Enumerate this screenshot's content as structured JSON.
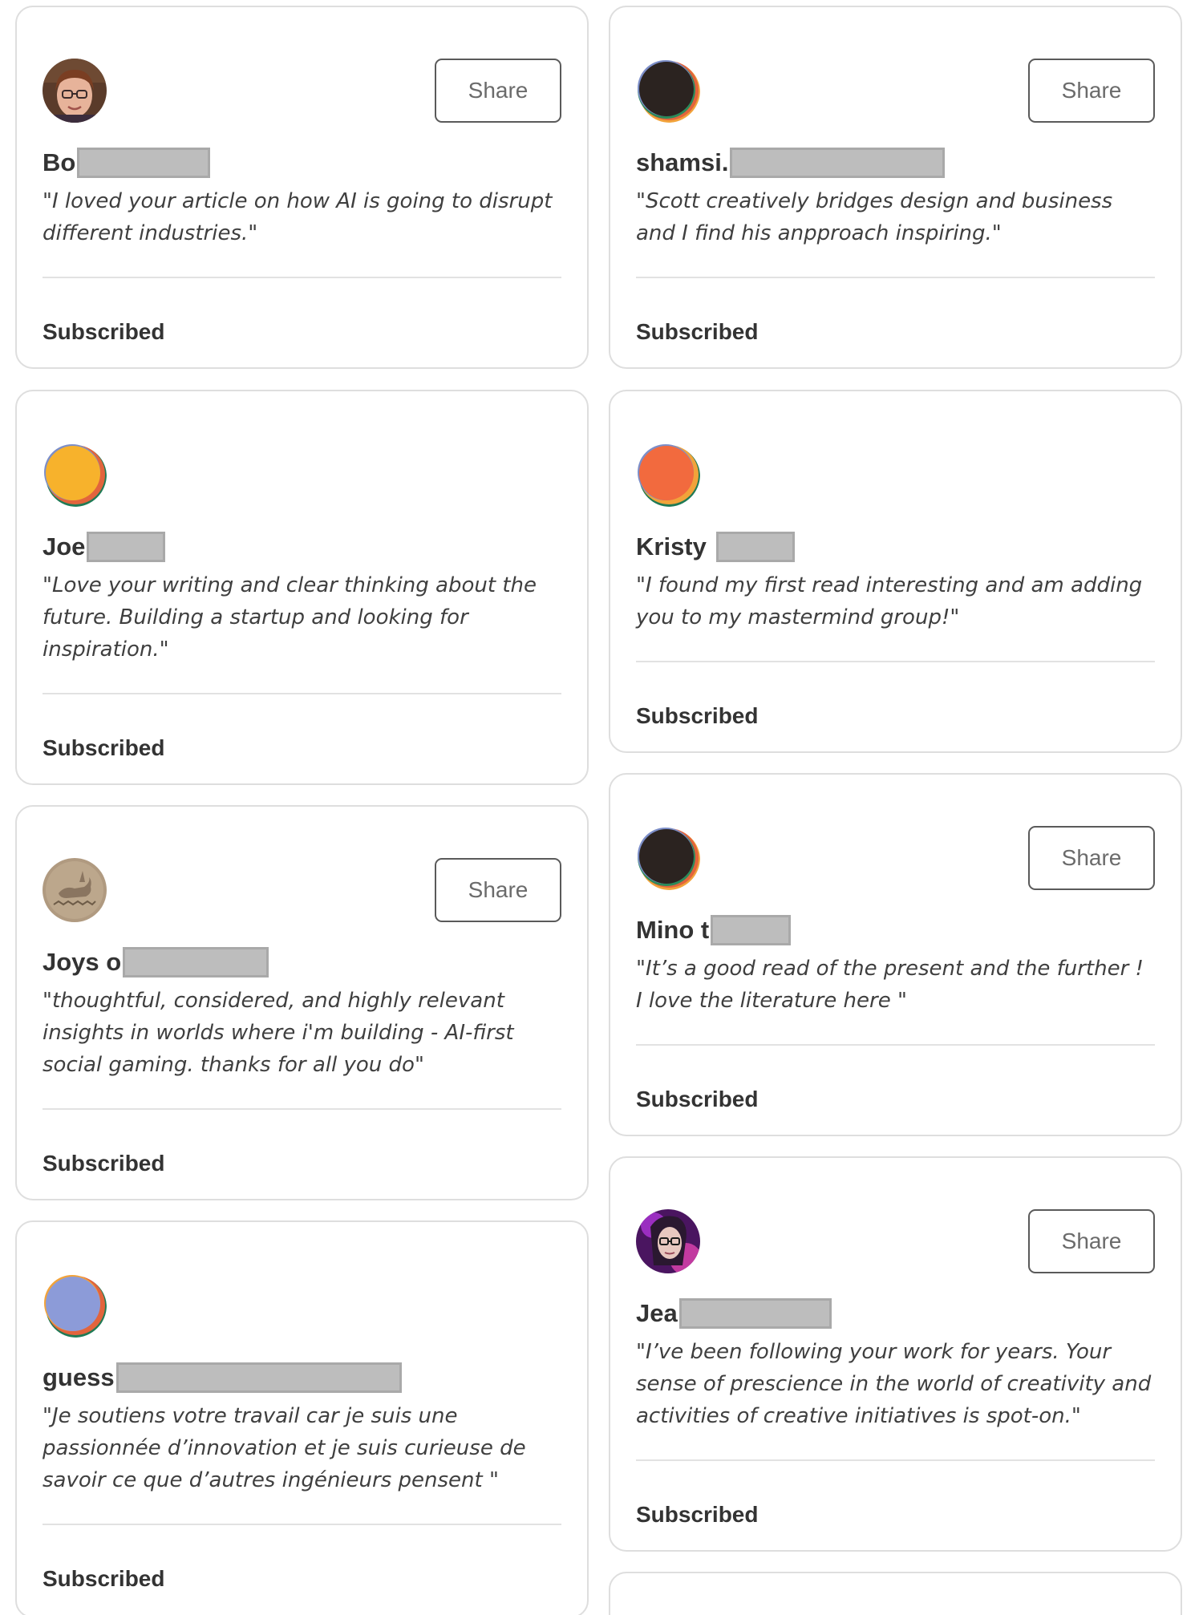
{
  "share_label": "Share",
  "cards": [
    {
      "name": "Bo",
      "quote": "\"I loved your article on how AI is going to disrupt different industries.\"",
      "status": "Subscribed",
      "avatar": "photo-woman-glasses"
    },
    {
      "name": "shamsi.",
      "quote": "\"Scott creatively bridges design and business and I find his anpproach inspiring.\"",
      "status": "Subscribed",
      "avatar": "dark-circle-default"
    },
    {
      "name": "Joe",
      "quote": "\"Love your writing and clear thinking about the future. Building a startup and looking for inspiration.\"",
      "status": "Subscribed",
      "avatar": "yellow-circle-default"
    },
    {
      "name": "Kristy",
      "quote": "\"I found my first read interesting and am adding you to my mastermind group!\"",
      "status": "Subscribed",
      "avatar": "orange-circle-default"
    },
    {
      "name": "Joys o",
      "quote": "\"thoughtful, considered, and highly relevant insights in worlds where i'm building - AI-first social gaming. thanks for all you do\"",
      "status": "Subscribed",
      "avatar": "stone-rabbit"
    },
    {
      "name": "Mino t",
      "quote": "\"It’s a good read of the present and the further ! I love the literature here \"",
      "status": "Subscribed",
      "avatar": "dark-circle-default"
    },
    {
      "name": "guess",
      "quote": "\"Je soutiens votre travail car je suis une passionnée d’innovation et je suis curieuse de savoir ce que d’autres ingénieurs pensent \"",
      "status": "Subscribed",
      "avatar": "blue-circle-default"
    },
    {
      "name": "Jea",
      "quote": "\"I’ve been following your work for years. Your sense of prescience in the world of creativity and activities of creative initiatives is spot-on.\"",
      "status": "Subscribed",
      "avatar": "photo-woman-purple"
    }
  ],
  "colors": {
    "card_border": "#dedede",
    "text": "#333333",
    "redaction": "#bdbdbd"
  }
}
